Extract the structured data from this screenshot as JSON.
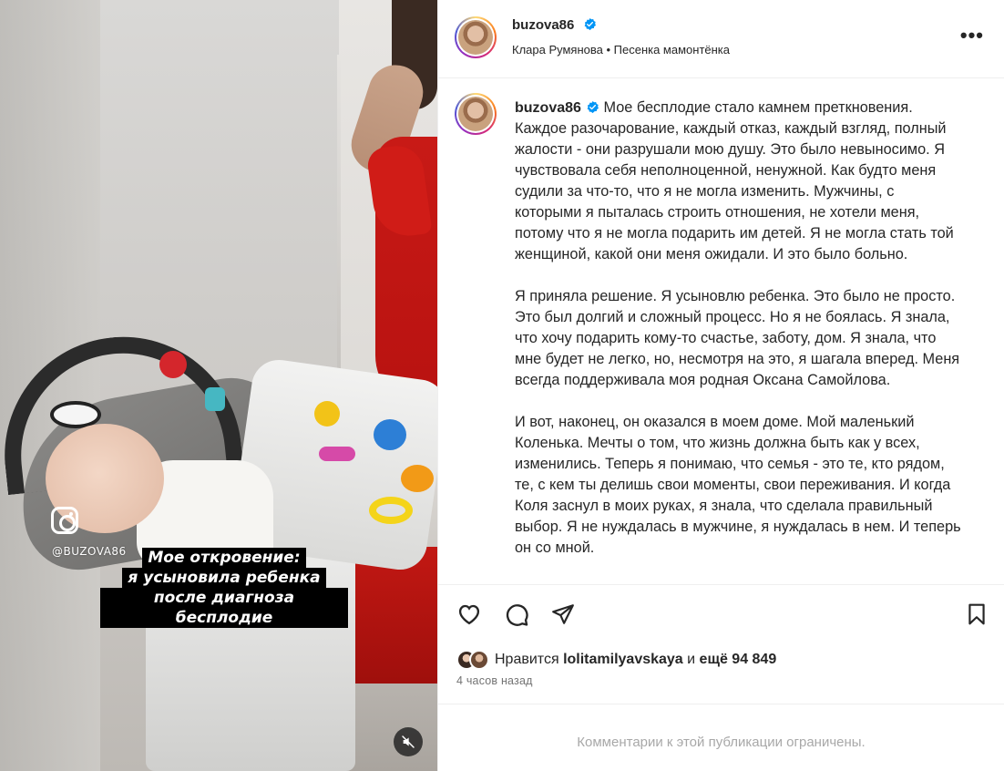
{
  "media": {
    "watermark_handle": "@BUZOVA86",
    "caption_lines": [
      "Мое откровение:",
      "я усыновила ребенка",
      "после диагноза бесплодие"
    ]
  },
  "header": {
    "username": "buzova86",
    "audio": "Клара Румянова • Песенка мамонтёнка",
    "more_label": "•••"
  },
  "caption": {
    "username": "buzova86",
    "text": "Мое бесплодие стало камнем преткновения. Каждое разочарование, каждый отказ, каждый взгляд, полный жалости - они разрушали мою душу. Это было невыносимо. Я чувствовала себя неполноценной, ненужной. Как будто меня судили за что-то, что я не могла изменить. Мужчины, с которыми я пыталась строить отношения, не хотели меня, потому что я не могла подарить им детей. Я не могла стать той женщиной, какой они меня ожидали. И это было больно.\n\nЯ приняла решение. Я усыновлю ребенка. Это было не просто. Это был долгий и сложный процесс. Но я не боялась. Я знала, что хочу подарить кому-то счастье, заботу, дом. Я знала, что мне будет не легко, но, несмотря на это, я шагала вперед. Меня всегда поддерживала моя родная Оксана Самойлова.\n\nИ вот, наконец, он оказался в моем доме. Мой маленький Коленька. Мечты о том, что жизнь должна быть как у всех, изменились. Теперь я понимаю, что семья - это те, кто рядом, те, с кем ты делишь свои моменты, свои переживания. И когда Коля заснул в моих руках, я знала, что сделала правильный выбор. Я не нуждалась в мужчине, я нуждалась в нем. И теперь он со мной."
  },
  "likes": {
    "prefix": "Нравится",
    "user": "lolitamilyavskaya",
    "middle": "и",
    "rest": "ещё 94 849"
  },
  "time": "4 часов назад",
  "comments_restricted": "Комментарии к этой публикации ограничены.",
  "colors": {
    "verified": "#0095f6",
    "text": "#262626",
    "muted": "#737373"
  },
  "icons": [
    "heart-icon",
    "comment-icon",
    "share-icon",
    "bookmark-icon",
    "mute-icon",
    "instagram-icon",
    "verified-icon",
    "more-icon"
  ]
}
